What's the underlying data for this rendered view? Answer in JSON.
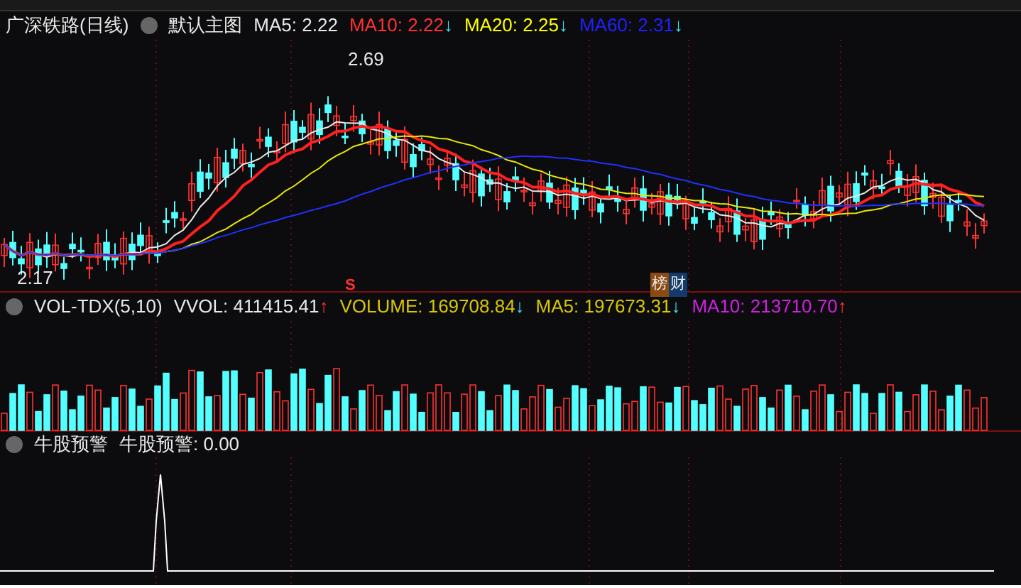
{
  "main_chart": {
    "title": "广深铁路(日线)",
    "template": "默认主图",
    "indicators": [
      {
        "text": "MA5: 2.22",
        "color": "#e8e8e8"
      },
      {
        "text": "MA10: 2.22",
        "arrow": "↓",
        "color": "#ff3232"
      },
      {
        "text": "MA20: 2.25",
        "arrow": "↓",
        "color": "#ffff00"
      },
      {
        "text": "MA60: 2.31",
        "arrow": "↓",
        "color": "#2020ff"
      }
    ],
    "high_label": "2.69",
    "low_label": "2.17",
    "signal_mark": "S",
    "badges": [
      {
        "text": "榜",
        "color": "#8b4a10"
      },
      {
        "text": "财",
        "color": "#123a6a"
      }
    ]
  },
  "volume_chart": {
    "title": "VOL-TDX(5,10)",
    "indicators": [
      {
        "text": "VVOL: 411415.41",
        "arrow": "↑",
        "color": "#e8e8e8"
      },
      {
        "text": "VOLUME: 169708.84",
        "arrow": "↓",
        "color": "#d8c800"
      },
      {
        "text": "MA5: 197673.31",
        "arrow": "↓",
        "color": "#d8c800"
      },
      {
        "text": "MA10: 213710.70",
        "arrow": "↑",
        "color": "#d020e0"
      }
    ]
  },
  "alert_chart": {
    "title": "牛股预警",
    "reading": "牛股预警: 0.00"
  }
}
